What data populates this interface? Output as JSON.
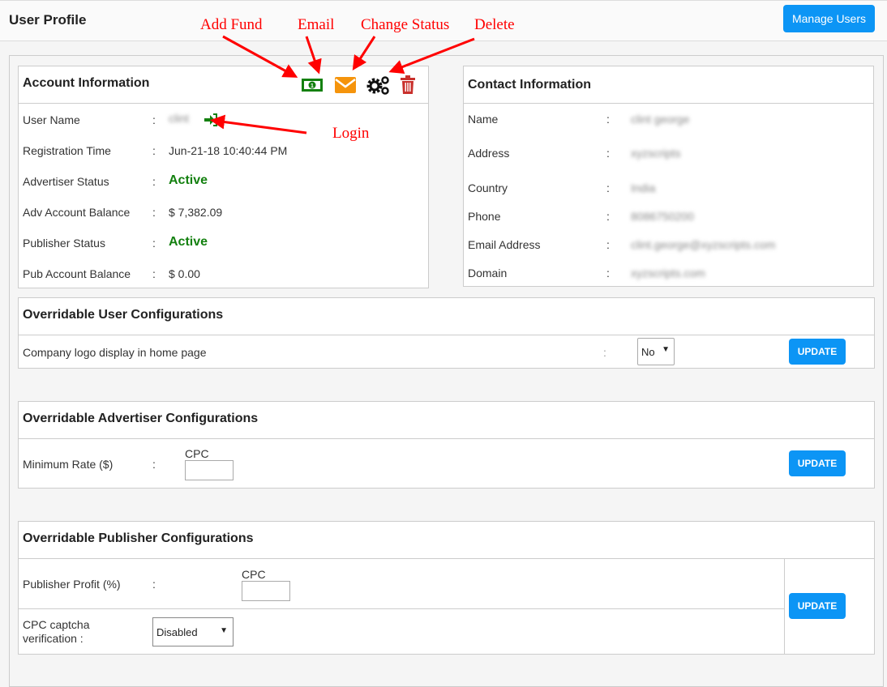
{
  "header": {
    "title": "User Profile",
    "manage_users": "Manage Users"
  },
  "account": {
    "title": "Account Information",
    "actions": [
      {
        "icon": "money-bill-icon",
        "color": "#13800f"
      },
      {
        "icon": "envelope-icon",
        "color": "#f5940c"
      },
      {
        "icon": "cogs-icon",
        "color": "#111111"
      },
      {
        "icon": "trash-icon",
        "color": "#c9302c"
      }
    ],
    "rows": [
      {
        "label": "User Name",
        "value": "clint"
      },
      {
        "label": "Registration Time",
        "value": "Jun-21-18 10:40:44 PM"
      },
      {
        "label": "Advertiser Status",
        "value": "Active"
      },
      {
        "label": "Adv Account Balance",
        "value": "$ 7,382.09"
      },
      {
        "label": "Publisher Status",
        "value": "Active"
      },
      {
        "label": "Pub Account Balance",
        "value": "$ 0.00"
      }
    ]
  },
  "contact": {
    "title": "Contact Information",
    "rows": [
      {
        "label": "Name",
        "value": "clint george"
      },
      {
        "label": "Address",
        "value": "xyzscripts"
      },
      {
        "label": "Country",
        "value": "India"
      },
      {
        "label": "Phone",
        "value": "8086750200"
      },
      {
        "label": "Email Address",
        "value": "clint.george@xyzscripts.com"
      },
      {
        "label": "Domain",
        "value": "xyzscripts.com"
      }
    ]
  },
  "user_config": {
    "title": "Overridable User Configurations",
    "label": "Company logo display in home page",
    "select": "No",
    "update": "UPDATE"
  },
  "adv_config": {
    "title": "Overridable Advertiser Configurations",
    "label": "Minimum Rate ($)",
    "cpc": "CPC",
    "update": "UPDATE"
  },
  "pub_config": {
    "title": "Overridable Publisher Configurations",
    "profit_label": "Publisher Profit (%)",
    "cpc": "CPC",
    "captcha_label": "CPC captcha verification :",
    "captcha_select": "Disabled",
    "update": "UPDATE"
  },
  "annotations": {
    "add_fund": "Add Fund",
    "email": "Email",
    "change_status": "Change Status",
    "delete": "Delete",
    "login": "Login",
    "color": "#ff0000"
  }
}
